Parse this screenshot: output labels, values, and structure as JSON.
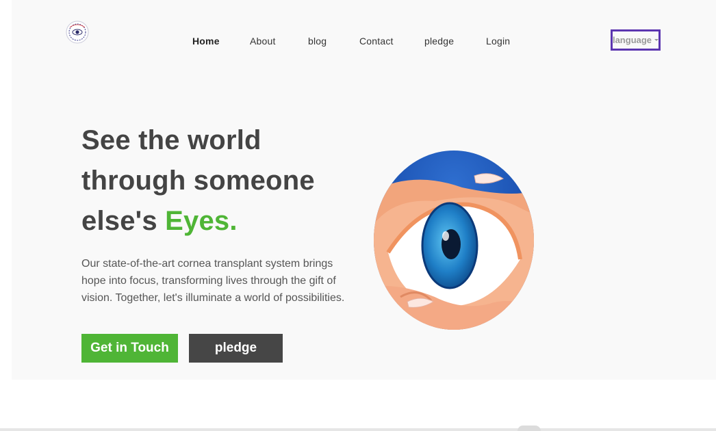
{
  "nav": {
    "items": [
      {
        "label": "Home"
      },
      {
        "label": "About"
      },
      {
        "label": "blog"
      },
      {
        "label": "Contact"
      },
      {
        "label": "pledge"
      },
      {
        "label": "Login"
      }
    ],
    "language_label": "language"
  },
  "hero": {
    "headline_line1": "See the world",
    "headline_line2": "through someone",
    "headline_line3_prefix": "else's ",
    "headline_accent": "Eyes.",
    "description": "Our state-of-the-art cornea transplant system brings hope into focus, transforming lives through the gift of vision. Together, let's illuminate a world of possibilities.",
    "primary_button": "Get in Touch",
    "secondary_button": "pledge"
  },
  "colors": {
    "accent_green": "#4fb536",
    "dark_button": "#464646",
    "language_border": "#5b35b0"
  },
  "icons": {
    "logo": "eye-logo-icon",
    "hero_image": "eye-hand-illustration",
    "language_caret": "caret-down-icon"
  }
}
